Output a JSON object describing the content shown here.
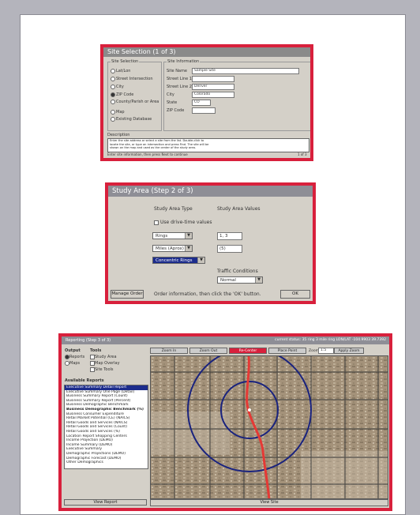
{
  "shot1": {
    "title": "Site Selection (1 of 3)",
    "group_left_label": "Site Selection",
    "left_options": [
      "Lat/Lon",
      "Street Intersection",
      "City",
      "ZIP Code",
      "County/Parish or Area",
      "Map",
      "Existing Database"
    ],
    "group_right_label": "Site Information",
    "right_labels": [
      "Site Name",
      "Street Line 1",
      "Street Line 2",
      "City",
      "State",
      "ZIP Code"
    ],
    "right_values": [
      "Sample Site",
      "",
      "Denver",
      "Colorado",
      "CO",
      ""
    ],
    "desc_label": "Description",
    "desc_lines": [
      "Enter the site address or select a site from the list. Double-click to",
      "locate the site, or type an intersection and press Find. The site will be",
      "shown on the map and used as the center of the study area."
    ],
    "status_text": "Enter site information, then press Next to continue",
    "status_right": "1 of 3"
  },
  "shot2": {
    "title": "Study Area (Step 2 of 3)",
    "col1_label": "Study Area Type",
    "col2_label": "Study Area Values",
    "checkbox_label": "Use drive-time values",
    "ring_type": "Rings",
    "ring_value": "1, 3",
    "unit_value": "Miles (Aprox)",
    "unit_field": "(5)",
    "selected_option": "Concentric Rings",
    "traffic_label": "Traffic Conditions",
    "traffic_value": "Normal",
    "bottom_left_btn": "Manage Order",
    "bottom_text": "Order information, then click the 'OK' button.",
    "ok_btn": "OK"
  },
  "shot3": {
    "title": "Reporting (Step 3 of 3)",
    "title_right": "current status: 35 ring 3 mile ring  LON/LAT -104.9903 39.7392",
    "output_label": "Output",
    "tools_label": "Tools",
    "output_options": [
      "Reports",
      "Maps"
    ],
    "tools_options": [
      "Study Area",
      "Map Overlay",
      "Site Tools"
    ],
    "reports_label": "Available Reports",
    "reports": [
      "Executive Summary Detail Report",
      "Executive Summary One Page (Detail)",
      "Business Summary Report (Count)",
      "Business Summary Report (Percent)",
      "Business Demographic Benchmark",
      "Business Demographic Benchmark (%)",
      "Business Consumer Expenditure",
      "Retail Market Potential (CE) (NAICS)",
      "Retail Goods and Services (NAICS)",
      "Retail Goods and Services (Count)",
      "Retail Goods and Services (%)",
      "Location Report Shopping Centers",
      "Income Projection (DEMO)",
      "Income Summary (DEMO)",
      "Executive Summary",
      "Demographic Projections (DEMO)",
      "Demographic Forecast (DEMO)",
      "Other Demographics"
    ],
    "view_report_btn": "View Report",
    "map_buttons": [
      "Zoom In",
      "Zoom Out",
      "Re-Center",
      "Place Point",
      "Zoom",
      "Apply Zoom"
    ],
    "zoom_value": "1:5",
    "view_site_btn": "View Site",
    "colors": {
      "ring": "#1a237e",
      "route": "#e53935",
      "accent": "#d8203c"
    }
  }
}
